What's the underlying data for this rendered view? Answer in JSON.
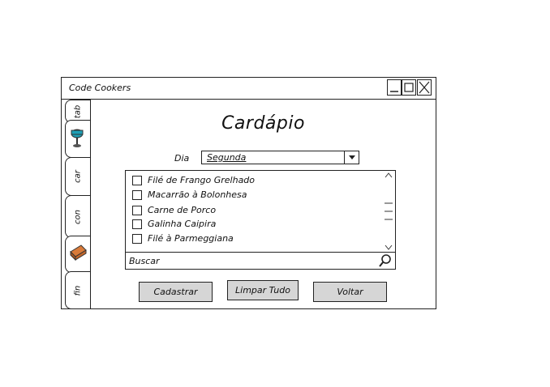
{
  "window": {
    "title": "Code Cookers",
    "controls": [
      "minimize-icon",
      "maximize-icon",
      "close-icon"
    ]
  },
  "tabs": [
    {
      "label": "tab"
    },
    {
      "label": "",
      "icon": "cocktail-icon"
    },
    {
      "label": "car"
    },
    {
      "label": "con"
    },
    {
      "label": "",
      "icon": "brick-icon"
    },
    {
      "label": "fin"
    }
  ],
  "page": {
    "title": "Cardápio",
    "day_label": "Dia",
    "day_value": "Segunda"
  },
  "menu_items": [
    {
      "label": "Filé de Frango Grelhado",
      "checked": false
    },
    {
      "label": "Macarrão à Bolonhesa",
      "checked": false
    },
    {
      "label": "Carne de Porco",
      "checked": false
    },
    {
      "label": "Galinha Caipira",
      "checked": false
    },
    {
      "label": "Filé à Parmeggiana",
      "checked": false
    }
  ],
  "search": {
    "placeholder": "Buscar",
    "icon": "search-icon"
  },
  "buttons": {
    "register": "Cadastrar",
    "clear": "Limpar Tudo",
    "back": "Voltar"
  }
}
